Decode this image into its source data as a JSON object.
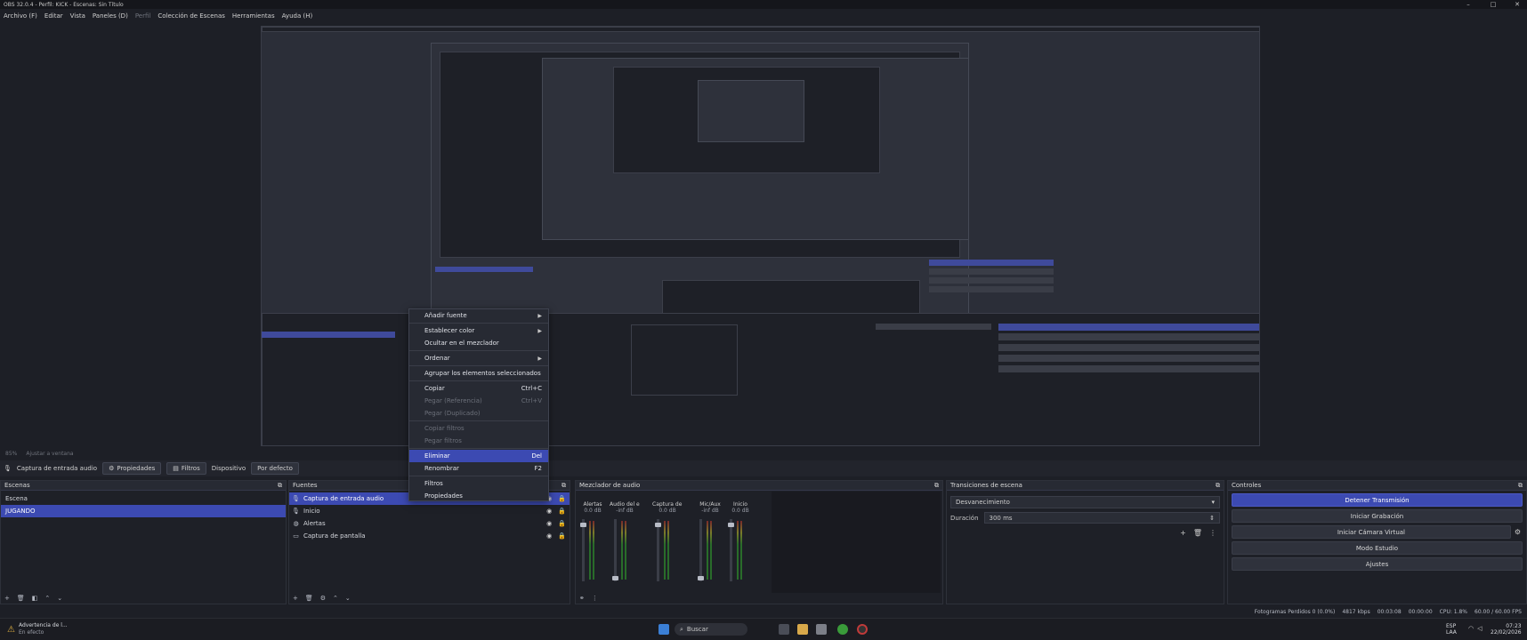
{
  "window": {
    "title": "OBS 32.0.4 - Perfil: KICK - Escenas: Sin Título",
    "minimize": "–",
    "maximize": "□",
    "close": "✕"
  },
  "menu": {
    "items": [
      "Archivo (F)",
      "Editar",
      "Vista",
      "Paneles (D)"
    ],
    "disabled": "Perfil",
    "items2": [
      "Colección de Escenas",
      "Herramientas",
      "Ayuda (H)"
    ]
  },
  "preview_status": {
    "zoom": "85%",
    "scale": "Ajustar a ventana"
  },
  "source_toolbar": {
    "current": "Captura de entrada audio",
    "properties": "Propiedades",
    "filters": "Filtros",
    "device_label": "Dispositivo",
    "device_value": "Por defecto"
  },
  "scenes": {
    "title": "Escenas",
    "items": [
      "Escena",
      "JUGANDO"
    ],
    "selected": 1
  },
  "sources": {
    "title": "Fuentes",
    "items": [
      {
        "label": "Captura de entrada audio",
        "icon": "microphone-icon",
        "glyph": "🎙"
      },
      {
        "label": "Inicio",
        "icon": "microphone-icon",
        "glyph": "🎙"
      },
      {
        "label": "Alertas",
        "icon": "globe-icon",
        "glyph": "◍"
      },
      {
        "label": "Captura de pantalla",
        "icon": "monitor-icon",
        "glyph": "▭"
      }
    ],
    "selected": 0
  },
  "mixer": {
    "title": "Mezclador de audio",
    "channels": [
      {
        "name": "Alertas",
        "db": "0.0 dB"
      },
      {
        "name": "Audio del escritorio",
        "db": "-inf dB"
      },
      {
        "name": "Captura de entrada",
        "db": "0.0 dB"
      },
      {
        "name": "Mic/Aux",
        "db": "-inf dB"
      },
      {
        "name": "Inicio",
        "db": "0.0 dB"
      }
    ]
  },
  "transitions": {
    "title": "Transiciones de escena",
    "selected": "Desvanecimiento",
    "duration_label": "Duración",
    "duration_value": "300 ms"
  },
  "controls": {
    "title": "Controles",
    "stop_stream": "Detener Transmisión",
    "start_recording": "Iniciar Grabación",
    "start_virtualcam": "Iniciar Cámara Virtual",
    "studio_mode": "Modo Estudio",
    "settings": "Ajustes"
  },
  "context_menu": {
    "items": [
      {
        "label": "Añadir fuente",
        "shortcut": "",
        "submenu": true,
        "state": "normal"
      },
      {
        "sep": true
      },
      {
        "label": "Establecer color",
        "shortcut": "",
        "submenu": true,
        "state": "normal"
      },
      {
        "label": "Ocultar en el mezclador",
        "shortcut": "",
        "submenu": false,
        "state": "normal"
      },
      {
        "sep": true
      },
      {
        "label": "Ordenar",
        "shortcut": "",
        "submenu": true,
        "state": "normal"
      },
      {
        "sep": true
      },
      {
        "label": "Agrupar los elementos seleccionados",
        "shortcut": "",
        "submenu": false,
        "state": "normal"
      },
      {
        "sep": true
      },
      {
        "label": "Copiar",
        "shortcut": "Ctrl+C",
        "submenu": false,
        "state": "normal"
      },
      {
        "label": "Pegar (Referencia)",
        "shortcut": "Ctrl+V",
        "submenu": false,
        "state": "disabled"
      },
      {
        "label": "Pegar (Duplicado)",
        "shortcut": "",
        "submenu": false,
        "state": "disabled"
      },
      {
        "sep": true
      },
      {
        "label": "Copiar filtros",
        "shortcut": "",
        "submenu": false,
        "state": "disabled"
      },
      {
        "label": "Pegar filtros",
        "shortcut": "",
        "submenu": false,
        "state": "disabled"
      },
      {
        "sep": true
      },
      {
        "label": "Eliminar",
        "shortcut": "Del",
        "submenu": false,
        "state": "active"
      },
      {
        "label": "Renombrar",
        "shortcut": "F2",
        "submenu": false,
        "state": "normal"
      },
      {
        "sep": true
      },
      {
        "label": "Filtros",
        "shortcut": "",
        "submenu": false,
        "state": "normal"
      },
      {
        "label": "Propiedades",
        "shortcut": "",
        "submenu": false,
        "state": "normal"
      }
    ]
  },
  "status": {
    "dropped": "Fotogramas Perdidos 0 (0.0%)",
    "bitrate": "4817 kbps",
    "stream_time": "00:03:08",
    "rec_time": "00:00:00",
    "cpu": "CPU: 1.8%",
    "fps": "60.00 / 60.00 FPS"
  },
  "taskbar": {
    "notification_title": "Advertencia de l...",
    "notification_sub": "En efecto",
    "search": "Buscar",
    "lang": "ESP",
    "lang_sub": "LAA",
    "time": "07:23",
    "date": "22/02/2026"
  },
  "colors": {
    "accent": "#3c4ab2",
    "panel": "#1e2027",
    "header": "#272a33"
  }
}
